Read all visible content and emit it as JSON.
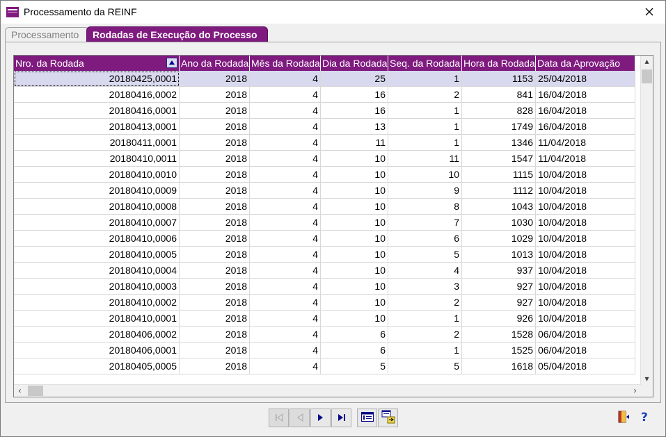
{
  "window": {
    "title": "Processamento da REINF"
  },
  "tabs": [
    {
      "label": "Processamento"
    },
    {
      "label": "Rodadas de Execução do Processo"
    }
  ],
  "grid": {
    "columns": [
      "Nro. da Rodada",
      "Ano da Rodada",
      "Mês da Rodada",
      "Dia da Rodada",
      "Seq. da Rodada",
      "Hora da Rodada",
      "Data da Aprovação"
    ],
    "rows": [
      [
        "20180425,0001",
        "2018",
        "4",
        "25",
        "1",
        "1153",
        "25/04/2018"
      ],
      [
        "20180416,0002",
        "2018",
        "4",
        "16",
        "2",
        "841",
        "16/04/2018"
      ],
      [
        "20180416,0001",
        "2018",
        "4",
        "16",
        "1",
        "828",
        "16/04/2018"
      ],
      [
        "20180413,0001",
        "2018",
        "4",
        "13",
        "1",
        "1749",
        "16/04/2018"
      ],
      [
        "20180411,0001",
        "2018",
        "4",
        "11",
        "1",
        "1346",
        "11/04/2018"
      ],
      [
        "20180410,0011",
        "2018",
        "4",
        "10",
        "11",
        "1547",
        "11/04/2018"
      ],
      [
        "20180410,0010",
        "2018",
        "4",
        "10",
        "10",
        "1115",
        "10/04/2018"
      ],
      [
        "20180410,0009",
        "2018",
        "4",
        "10",
        "9",
        "1112",
        "10/04/2018"
      ],
      [
        "20180410,0008",
        "2018",
        "4",
        "10",
        "8",
        "1043",
        "10/04/2018"
      ],
      [
        "20180410,0007",
        "2018",
        "4",
        "10",
        "7",
        "1030",
        "10/04/2018"
      ],
      [
        "20180410,0006",
        "2018",
        "4",
        "10",
        "6",
        "1029",
        "10/04/2018"
      ],
      [
        "20180410,0005",
        "2018",
        "4",
        "10",
        "5",
        "1013",
        "10/04/2018"
      ],
      [
        "20180410,0004",
        "2018",
        "4",
        "10",
        "4",
        "937",
        "10/04/2018"
      ],
      [
        "20180410,0003",
        "2018",
        "4",
        "10",
        "3",
        "927",
        "10/04/2018"
      ],
      [
        "20180410,0002",
        "2018",
        "4",
        "10",
        "2",
        "927",
        "10/04/2018"
      ],
      [
        "20180410,0001",
        "2018",
        "4",
        "10",
        "1",
        "926",
        "10/04/2018"
      ],
      [
        "20180406,0002",
        "2018",
        "4",
        "6",
        "2",
        "1528",
        "06/04/2018"
      ],
      [
        "20180406,0001",
        "2018",
        "4",
        "6",
        "1",
        "1525",
        "06/04/2018"
      ],
      [
        "20180405,0005",
        "2018",
        "4",
        "5",
        "5",
        "1618",
        "05/04/2018"
      ]
    ]
  },
  "colors": {
    "accent": "#7f1a7f",
    "selected_row": "#d8d8ee"
  },
  "icons": {
    "app": "purple-window-icon",
    "close": "close-icon",
    "first": "first-record-icon",
    "prev": "previous-record-icon",
    "next": "next-record-icon",
    "last": "last-record-icon",
    "view": "form-view-icon",
    "export": "grid-export-icon",
    "exit": "exit-door-icon",
    "help": "help-icon"
  }
}
